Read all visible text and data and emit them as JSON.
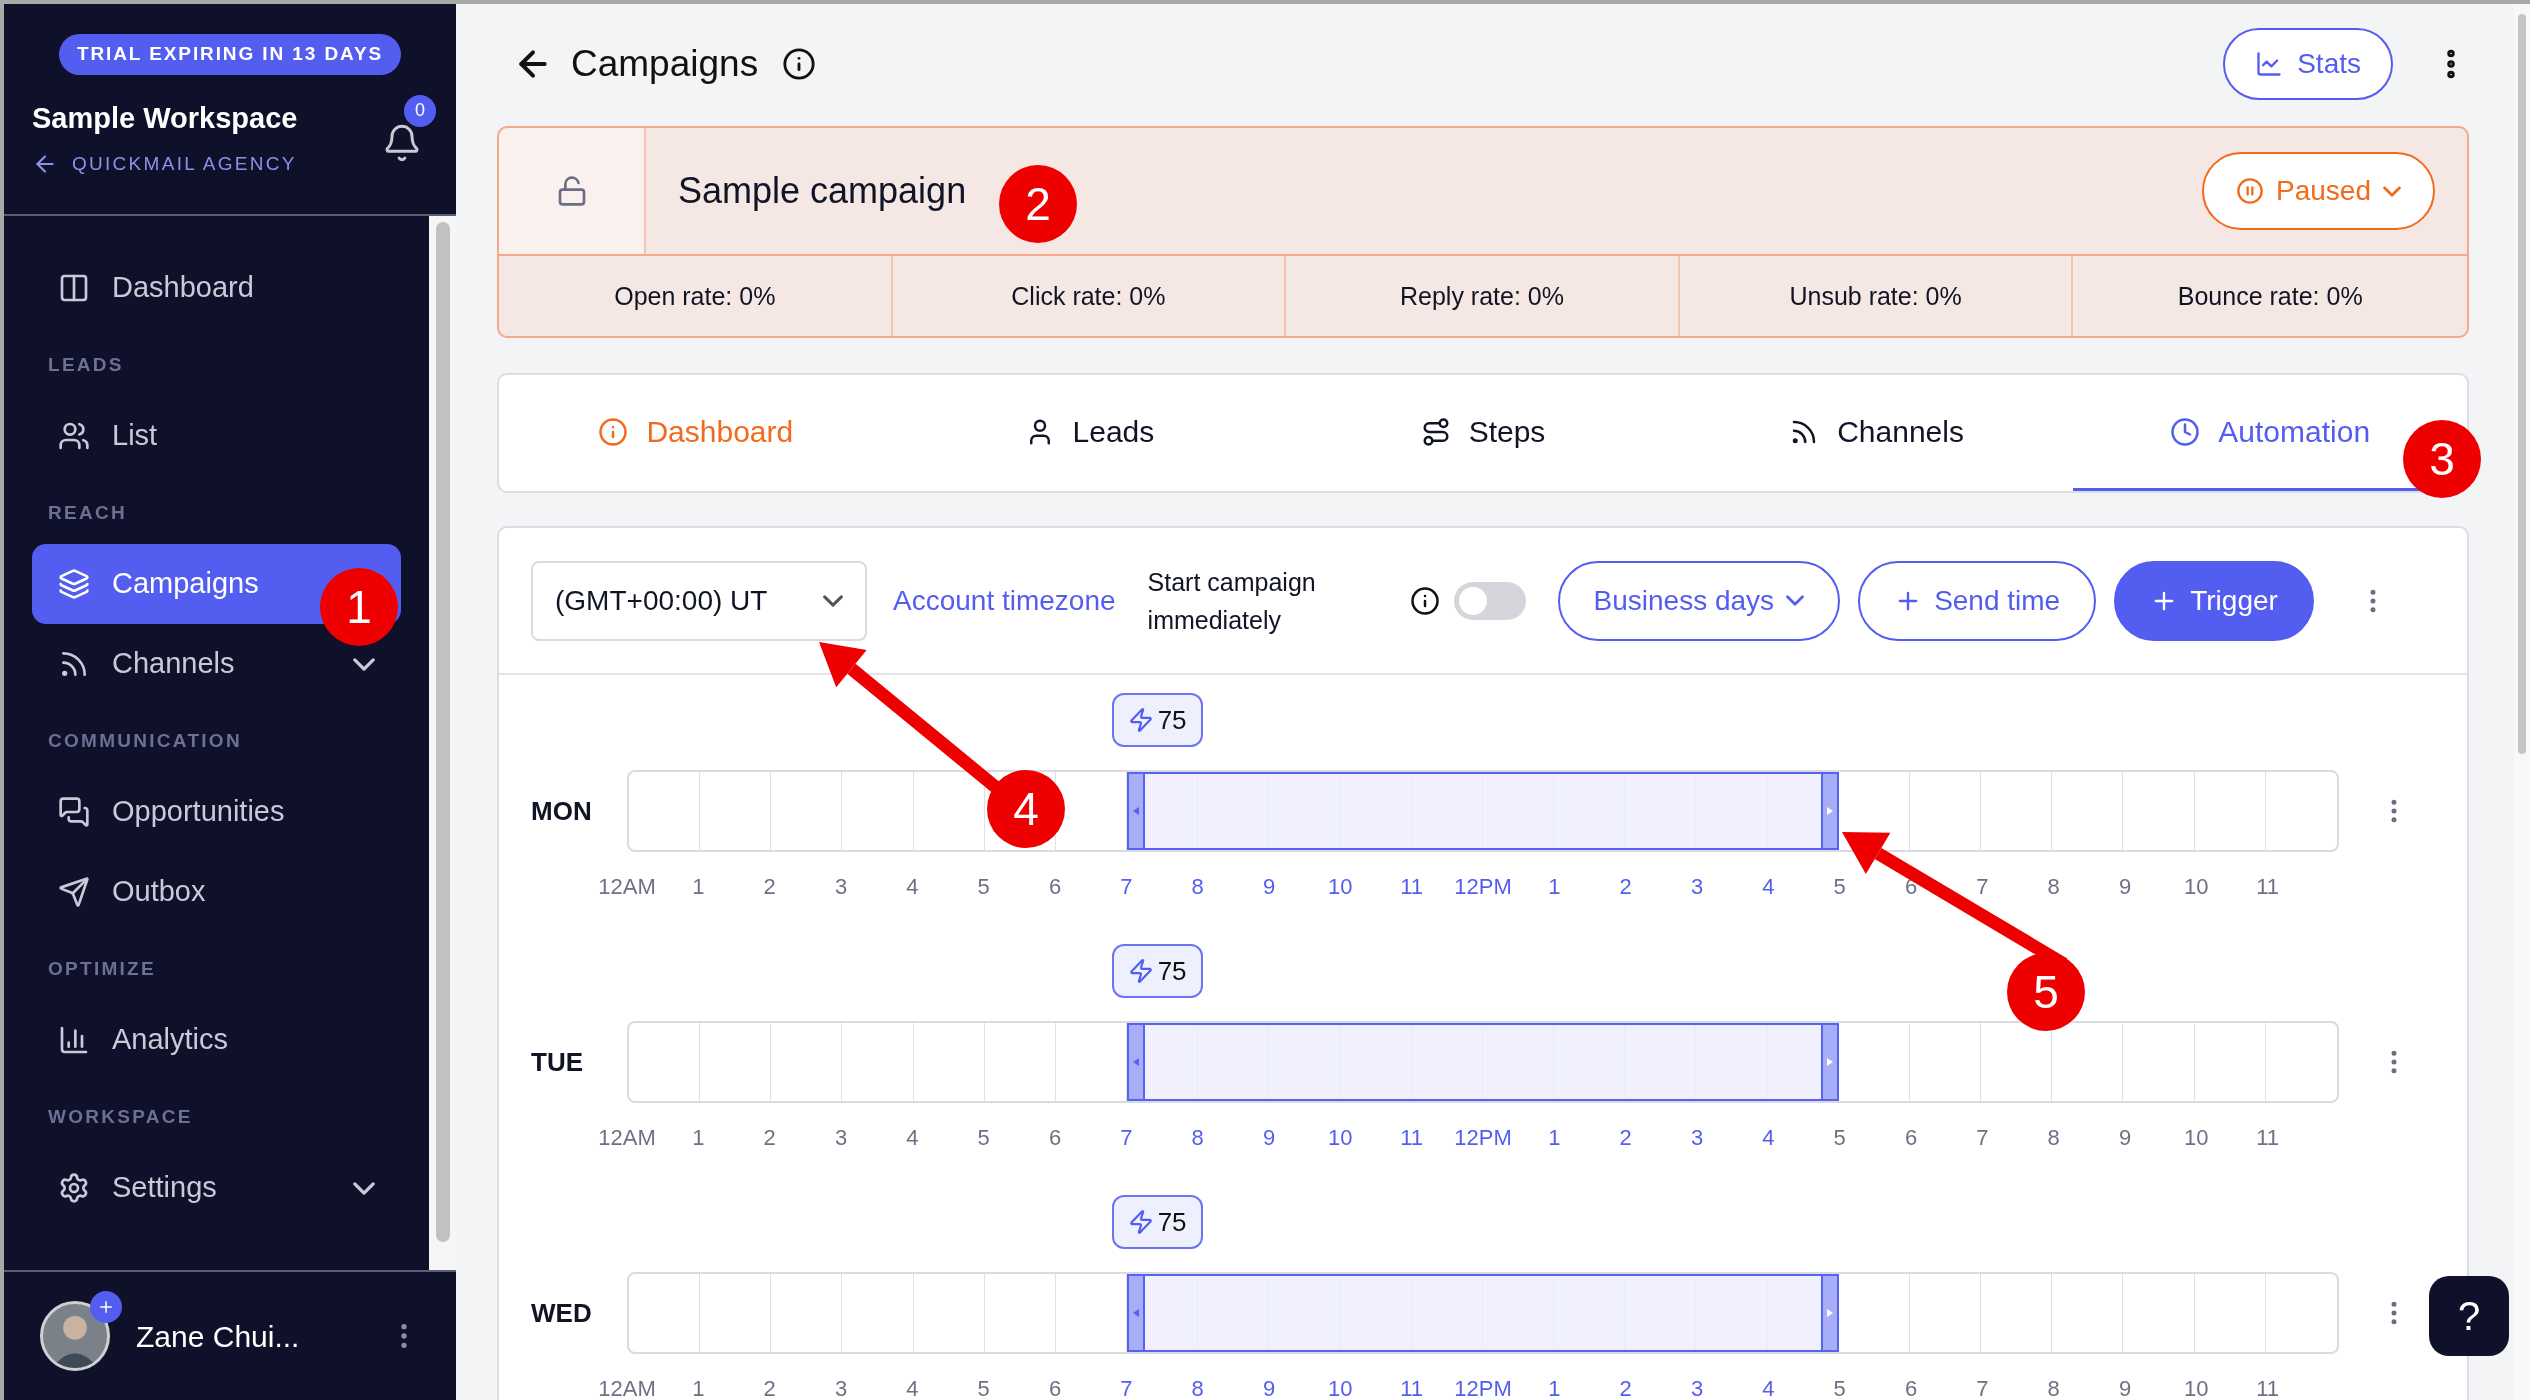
{
  "sidebar": {
    "trial_badge": "TRIAL EXPIRING IN 13 DAYS",
    "workspace_name": "Sample Workspace",
    "agency_link": "QUICKMAIL AGENCY",
    "notification_count": "0",
    "sections": [
      {
        "items": [
          {
            "label": "Dashboard",
            "selected": false,
            "kind": "link"
          }
        ]
      },
      {
        "heading": "LEADS",
        "items": [
          {
            "label": "List",
            "selected": false,
            "kind": "link"
          }
        ]
      },
      {
        "heading": "REACH",
        "items": [
          {
            "label": "Campaigns",
            "selected": true,
            "kind": "link"
          },
          {
            "label": "Channels",
            "selected": false,
            "kind": "group"
          }
        ]
      },
      {
        "heading": "COMMUNICATION",
        "items": [
          {
            "label": "Opportunities",
            "selected": false,
            "kind": "link"
          },
          {
            "label": "Outbox",
            "selected": false,
            "kind": "link"
          }
        ]
      },
      {
        "heading": "OPTIMIZE",
        "items": [
          {
            "label": "Analytics",
            "selected": false,
            "kind": "link"
          }
        ]
      },
      {
        "heading": "WORKSPACE",
        "items": [
          {
            "label": "Settings",
            "selected": false,
            "kind": "group"
          }
        ]
      }
    ],
    "user": {
      "name": "Zane Chui..."
    }
  },
  "header": {
    "title": "Campaigns",
    "stats_button": "Stats"
  },
  "campaign": {
    "name": "Sample campaign",
    "locked": false,
    "status": "Paused",
    "stats": [
      "Open rate: 0%",
      "Click rate: 0%",
      "Reply rate: 0%",
      "Unsub rate: 0%",
      "Bounce rate: 0%"
    ]
  },
  "tabs": [
    {
      "label": "Dashboard",
      "selected": false,
      "alert": true
    },
    {
      "label": "Leads",
      "selected": false,
      "alert": false
    },
    {
      "label": "Steps",
      "selected": false,
      "alert": false
    },
    {
      "label": "Channels",
      "selected": false,
      "alert": false
    },
    {
      "label": "Automation",
      "selected": true,
      "alert": false
    }
  ],
  "automation": {
    "timezone": "(GMT+00:00) UT",
    "timezone_link": "Account timezone",
    "start_immediately": {
      "label": "Start campaign immediately",
      "on": false
    },
    "buttons": [
      {
        "label": "Business days",
        "kind": "dropdown"
      },
      {
        "label": "Send time",
        "kind": "outline"
      },
      {
        "label": "Trigger",
        "kind": "primary"
      }
    ],
    "schedule": [
      {
        "day": "MON",
        "trigger_count": "75",
        "hours": [
          {
            "label": "12AM",
            "in_window": false
          },
          {
            "label": "1",
            "in_window": false
          },
          {
            "label": "2",
            "in_window": false
          },
          {
            "label": "3",
            "in_window": false
          },
          {
            "label": "4",
            "in_window": false
          },
          {
            "label": "5",
            "in_window": false
          },
          {
            "label": "6",
            "in_window": false
          },
          {
            "label": "7",
            "in_window": true
          },
          {
            "label": "8",
            "in_window": true
          },
          {
            "label": "9",
            "in_window": true
          },
          {
            "label": "10",
            "in_window": true
          },
          {
            "label": "11",
            "in_window": true
          },
          {
            "label": "12PM",
            "in_window": true
          },
          {
            "label": "1",
            "in_window": true
          },
          {
            "label": "2",
            "in_window": true
          },
          {
            "label": "3",
            "in_window": true
          },
          {
            "label": "4",
            "in_window": true
          },
          {
            "label": "5",
            "in_window": false
          },
          {
            "label": "6",
            "in_window": false
          },
          {
            "label": "7",
            "in_window": false
          },
          {
            "label": "8",
            "in_window": false
          },
          {
            "label": "9",
            "in_window": false
          },
          {
            "label": "10",
            "in_window": false
          },
          {
            "label": "11",
            "in_window": false
          }
        ]
      },
      {
        "day": "TUE",
        "trigger_count": "75",
        "hours": [
          {
            "label": "12AM",
            "in_window": false
          },
          {
            "label": "1",
            "in_window": false
          },
          {
            "label": "2",
            "in_window": false
          },
          {
            "label": "3",
            "in_window": false
          },
          {
            "label": "4",
            "in_window": false
          },
          {
            "label": "5",
            "in_window": false
          },
          {
            "label": "6",
            "in_window": false
          },
          {
            "label": "7",
            "in_window": true
          },
          {
            "label": "8",
            "in_window": true
          },
          {
            "label": "9",
            "in_window": true
          },
          {
            "label": "10",
            "in_window": true
          },
          {
            "label": "11",
            "in_window": true
          },
          {
            "label": "12PM",
            "in_window": true
          },
          {
            "label": "1",
            "in_window": true
          },
          {
            "label": "2",
            "in_window": true
          },
          {
            "label": "3",
            "in_window": true
          },
          {
            "label": "4",
            "in_window": true
          },
          {
            "label": "5",
            "in_window": false
          },
          {
            "label": "6",
            "in_window": false
          },
          {
            "label": "7",
            "in_window": false
          },
          {
            "label": "8",
            "in_window": false
          },
          {
            "label": "9",
            "in_window": false
          },
          {
            "label": "10",
            "in_window": false
          },
          {
            "label": "11",
            "in_window": false
          }
        ]
      },
      {
        "day": "WED",
        "trigger_count": "75",
        "hours": [
          {
            "label": "12AM",
            "in_window": false
          },
          {
            "label": "1",
            "in_window": false
          },
          {
            "label": "2",
            "in_window": false
          },
          {
            "label": "3",
            "in_window": false
          },
          {
            "label": "4",
            "in_window": false
          },
          {
            "label": "5",
            "in_window": false
          },
          {
            "label": "6",
            "in_window": false
          },
          {
            "label": "7",
            "in_window": true
          },
          {
            "label": "8",
            "in_window": true
          },
          {
            "label": "9",
            "in_window": true
          },
          {
            "label": "10",
            "in_window": true
          },
          {
            "label": "11",
            "in_window": true
          },
          {
            "label": "12PM",
            "in_window": true
          },
          {
            "label": "1",
            "in_window": true
          },
          {
            "label": "2",
            "in_window": true
          },
          {
            "label": "3",
            "in_window": true
          },
          {
            "label": "4",
            "in_window": true
          },
          {
            "label": "5",
            "in_window": false
          },
          {
            "label": "6",
            "in_window": false
          },
          {
            "label": "7",
            "in_window": false
          },
          {
            "label": "8",
            "in_window": false
          },
          {
            "label": "9",
            "in_window": false
          },
          {
            "label": "10",
            "in_window": false
          },
          {
            "label": "11",
            "in_window": false
          }
        ]
      }
    ]
  },
  "help_button": "?",
  "annotations": [
    "1",
    "2",
    "3",
    "4",
    "5"
  ]
}
